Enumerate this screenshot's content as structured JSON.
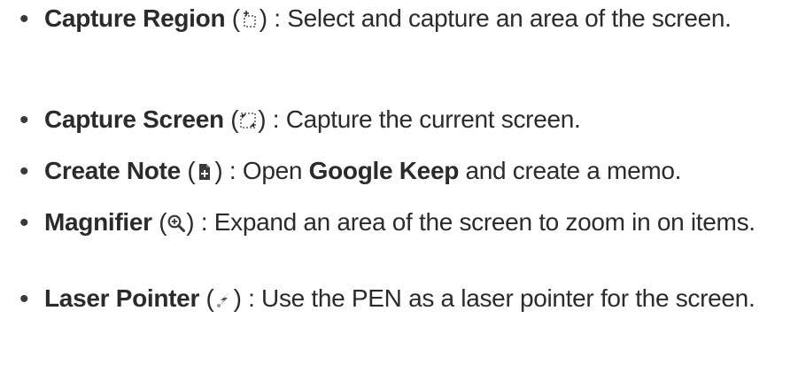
{
  "items": [
    {
      "term": "Capture Region",
      "icon": "capture-region-icon",
      "desc": " : Select and capture an area of the screen."
    },
    {
      "term": "Capture Screen",
      "icon": "capture-screen-icon",
      "desc": " : Capture the current screen."
    },
    {
      "term": "Create Note",
      "icon": "create-note-icon",
      "desc_before": " : Open ",
      "app": "Google Keep",
      "desc_after": " and create a memo."
    },
    {
      "term": "Magnifier",
      "icon": "magnifier-icon",
      "desc": " : Expand an area of the screen to zoom in on items."
    },
    {
      "term": "Laser Pointer",
      "icon": "laser-pointer-icon",
      "desc": " : Use the PEN as a laser pointer for the screen."
    }
  ],
  "bullet": "•",
  "paren_open": " (",
  "paren_close": ")"
}
